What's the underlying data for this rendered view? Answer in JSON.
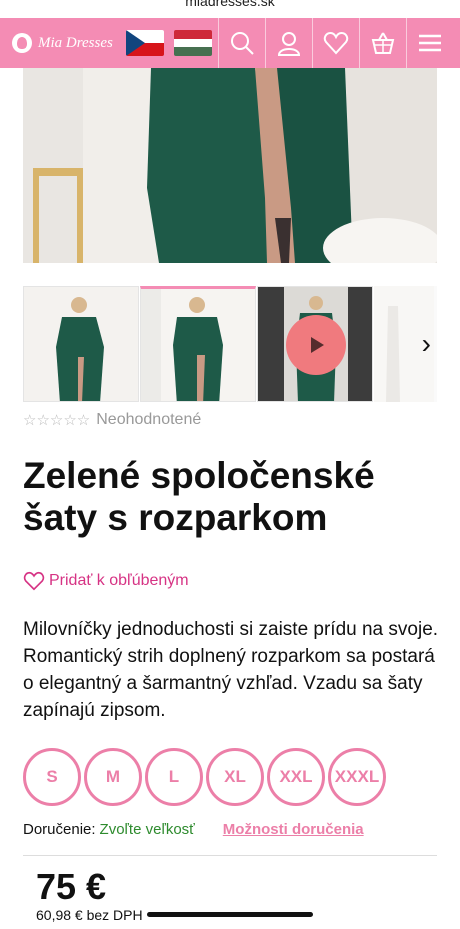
{
  "browser": {
    "url": "miadresses.sk"
  },
  "header": {
    "logo_text": "Mia Dresses",
    "flags": [
      "cz-flag",
      "hu-flag"
    ],
    "icons": [
      "search-icon",
      "user-icon",
      "heart-icon",
      "basket-icon",
      "menu-icon"
    ],
    "accent_color": "#f48cb4"
  },
  "gallery": {
    "thumbnail_count": 3,
    "active_thumbnail": 2,
    "video_thumbnail": 3,
    "next_icon": "chevron-right-icon"
  },
  "product": {
    "rating_text": "Neohodnotené",
    "rating_stars": 0,
    "title": "Zelené spoločenské šaty s rozparkom",
    "favorite_label": "Pridať k obľúbeným",
    "description": "Milovníčky jednoduchosti si zaiste prídu na svoje. Romantický strih doplnený rozparkom sa postará o elegantný a šarmantný vzhľad. Vzadu sa šaty zapínajú zipsom.",
    "sizes": [
      "S",
      "M",
      "L",
      "XL",
      "XXL",
      "XXXL"
    ],
    "delivery_label": "Doručenie:",
    "delivery_value": "Zvoľte veľkosť",
    "delivery_link": "Možnosti doručenia",
    "price": "75 €",
    "price_net": "60,98 € bez DPH"
  },
  "colors": {
    "pink": "#ec7fa8",
    "link_pink": "#d63384",
    "green": "#2e8b2e"
  }
}
